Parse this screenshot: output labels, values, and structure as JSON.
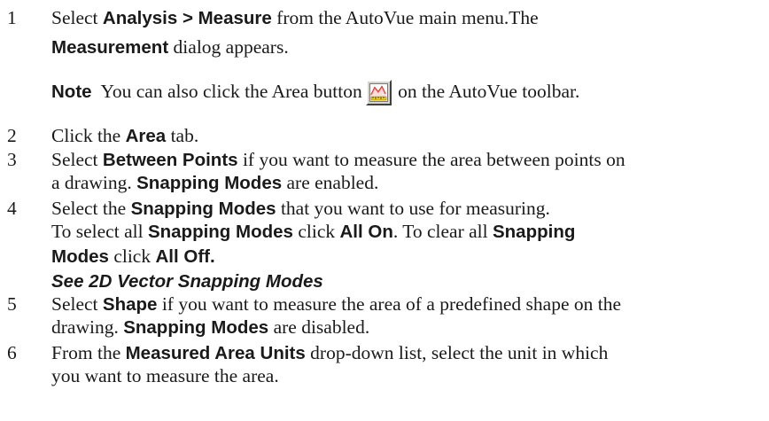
{
  "steps": [
    {
      "number": "1",
      "lines": [
        [
          "Select ",
          "Analysis > Measure",
          " from the AutoVue main menu.The"
        ],
        [
          "Measurement",
          " dialog appears."
        ]
      ]
    },
    {
      "note": {
        "label": "Note",
        "before": "You can also click the Area button",
        "after": " on the AutoVue toolbar.",
        "icon": "area-measure-icon"
      }
    },
    {
      "number": "2",
      "lines": [
        [
          "Click the ",
          "Area",
          " tab."
        ]
      ]
    },
    {
      "number": "3",
      "lines": [
        [
          "Select ",
          "Between Points",
          " if you want to measure the area between points on"
        ],
        [
          "a drawing. ",
          "Snapping Modes",
          " are enabled."
        ]
      ]
    },
    {
      "number": "4",
      "lines": [
        [
          "Select the ",
          "Snapping Modes",
          " that you want to use for measuring."
        ],
        [
          "To select all ",
          "Snapping Modes",
          " click ",
          "All On",
          ". To clear all ",
          "Snapping"
        ],
        [
          "Modes",
          " click ",
          "All Off."
        ],
        [
          "See  2D Vector Snapping Modes"
        ]
      ]
    },
    {
      "number": "5",
      "lines": [
        [
          "Select ",
          "Shape",
          " if you want to measure the area of a predefined shape on the"
        ],
        [
          "drawing. ",
          "Snapping Modes",
          " are disabled."
        ]
      ]
    },
    {
      "number": "6",
      "lines": [
        [
          "From the ",
          "Measured Area Units",
          " drop-down list, select the unit in which"
        ],
        [
          "you want to measure the area."
        ]
      ]
    }
  ]
}
